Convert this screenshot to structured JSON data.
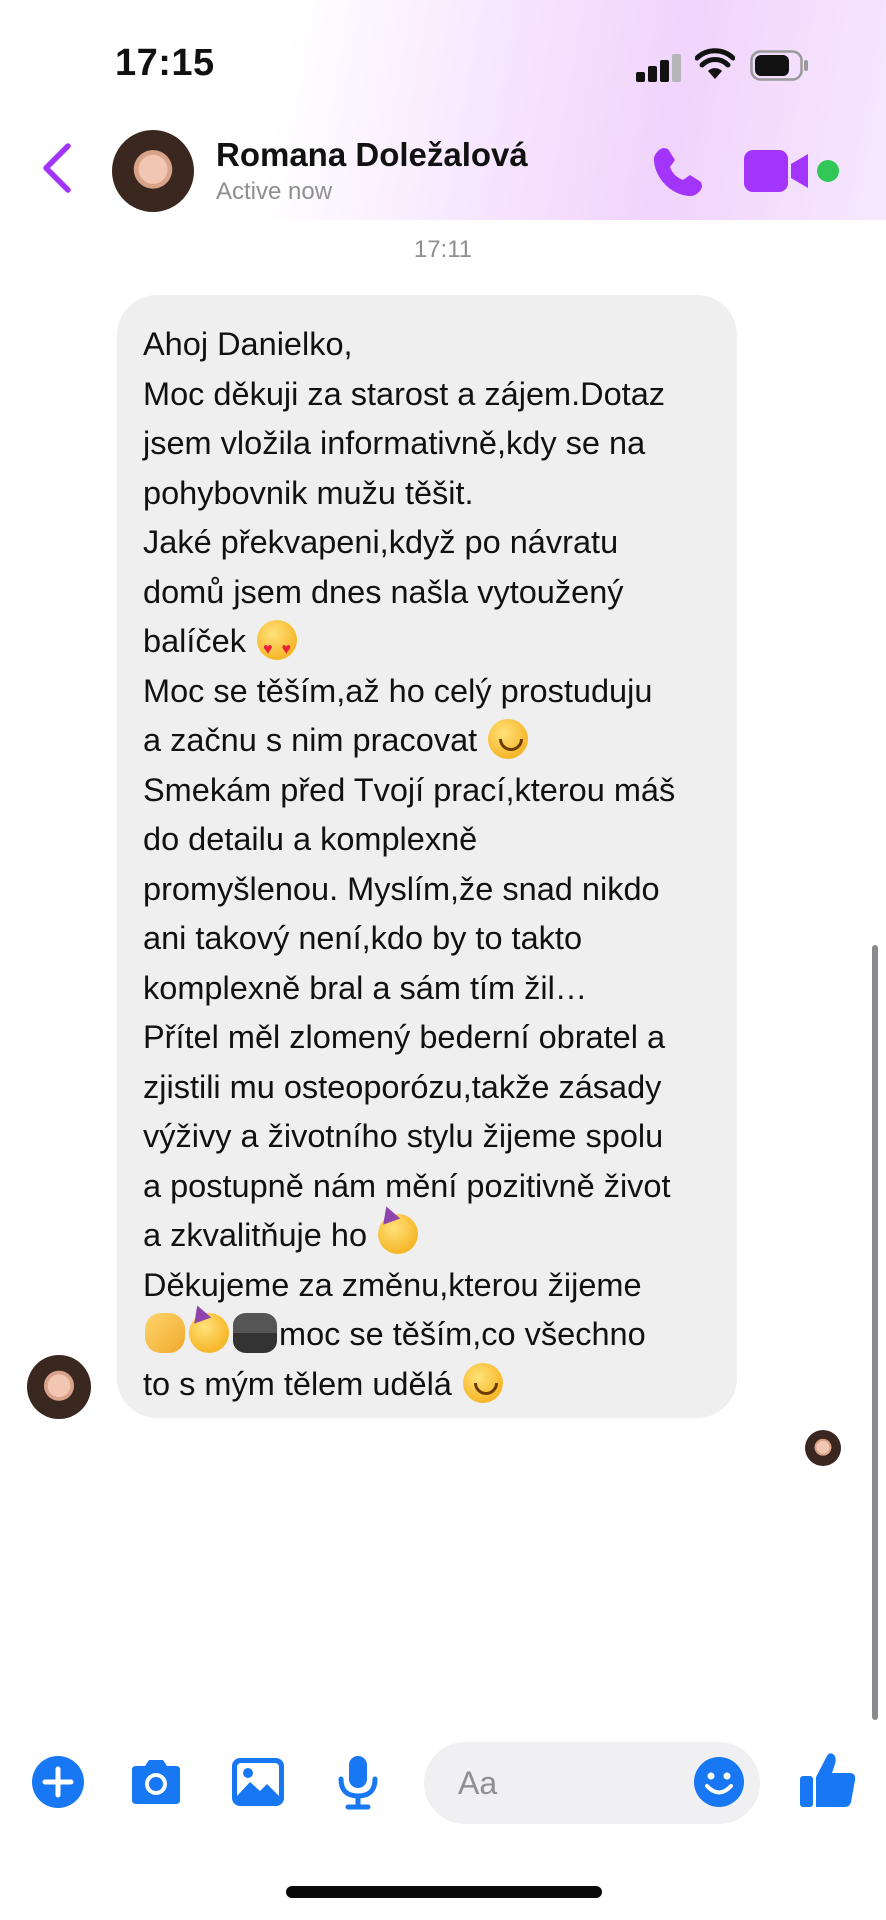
{
  "status_bar": {
    "time": "17:15"
  },
  "header": {
    "contact_name": "Romana Doležalová",
    "status": "Active now"
  },
  "thread": {
    "timestamp": "17:11",
    "message_lines": [
      "Ahoj Danielko,",
      "Moc děkuji za starost a zájem.Dotaz",
      "jsem vložila informativně,kdy se na",
      "pohybovnik mužu těšit.",
      "Jaké překvapeni,když po návratu",
      "domů jsem dnes našla vytoužený",
      "balíček",
      "Moc se těším,až ho celý prostuduju",
      "a začnu s nim pracovat",
      "Smekám před Tvojí prací,kterou máš",
      "do detailu a komplexně",
      "promyšlenou. Myslím,že snad nikdo",
      "ani takový není,kdo by to takto",
      "komplexně bral a sám tím žil…",
      "Přítel měl zlomený bederní obratel a",
      "zjistili mu osteoporózu,takže zásady",
      "výživy a životního stylu žijeme spolu",
      "a postupně nám mění pozitivně život",
      "a zkvalitňuje ho",
      "Děkujeme za změnu,kterou žijeme",
      "moc se těším,co všechno",
      "to s mým tělem udělá"
    ],
    "emojis": [
      "heart-eyes-emoji",
      "slight-smile-emoji",
      "partying-face-emoji",
      "clapping-hands-emoji",
      "partying-face-emoji",
      "footprints-emoji",
      "smiling-face-emoji"
    ]
  },
  "composer": {
    "placeholder": "Aa"
  },
  "colors": {
    "accent": "#a334fa",
    "blue": "#1877f2",
    "online": "#31c857",
    "bubble": "#efefef"
  }
}
